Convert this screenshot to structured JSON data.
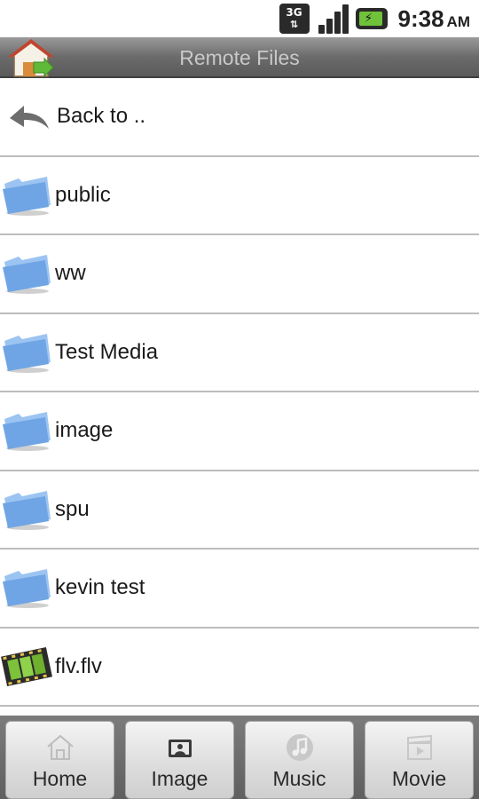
{
  "status_bar": {
    "network": "3G",
    "time": "9:38",
    "ampm": "AM"
  },
  "title_bar": {
    "title": "Remote Files",
    "home_icon": "home-exit-icon"
  },
  "list": {
    "back_label": "Back to ..",
    "items": [
      {
        "name": "public",
        "icon": "folder-icon"
      },
      {
        "name": "ww",
        "icon": "folder-icon"
      },
      {
        "name": "Test Media",
        "icon": "folder-icon"
      },
      {
        "name": "image",
        "icon": "folder-icon"
      },
      {
        "name": "spu",
        "icon": "folder-icon"
      },
      {
        "name": "kevin test",
        "icon": "folder-icon"
      },
      {
        "name": "flv.flv",
        "icon": "film-icon"
      }
    ]
  },
  "toolbar": {
    "tabs": [
      {
        "label": "Home",
        "icon": "home-icon"
      },
      {
        "label": "Image",
        "icon": "image-icon"
      },
      {
        "label": "Music",
        "icon": "music-icon"
      },
      {
        "label": "Movie",
        "icon": "movie-icon"
      }
    ]
  },
  "colors": {
    "title_bar": "#6b6b6b",
    "divider": "#bdbdbd",
    "folder": "#7fb0ea",
    "battery": "#6fc23a"
  }
}
